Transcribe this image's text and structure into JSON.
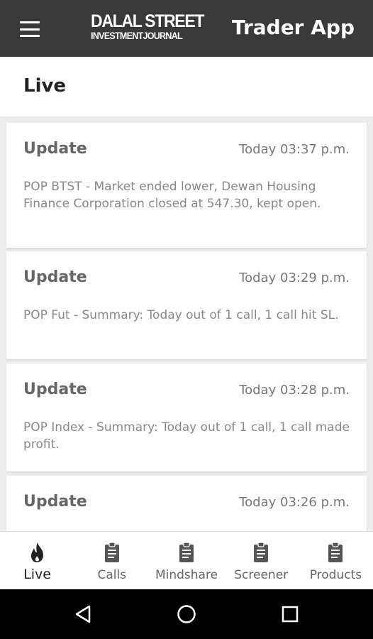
{
  "appbar": {
    "logo_line1": "DALAL STREET",
    "logo_line2": "INVESTMENTJOURNAL",
    "title": "Trader App"
  },
  "section": {
    "title": "Live"
  },
  "feed": [
    {
      "title": "Update",
      "time": "Today 03:37 p.m.",
      "body": "POP BTST - Market ended lower, Dewan Housing Finance Corporation closed at 547.30, kept open."
    },
    {
      "title": "Update",
      "time": "Today 03:29 p.m.",
      "body": "POP Fut - Summary: Today out of 1 call, 1 call hit SL."
    },
    {
      "title": "Update",
      "time": "Today 03:28 p.m.",
      "body": "POP Index - Summary: Today out of 1 call, 1 call made profit."
    },
    {
      "title": "Update",
      "time": "Today 03:26 p.m.",
      "body": ""
    }
  ],
  "bottom_nav": [
    {
      "label": "Live",
      "icon": "flame-icon",
      "active": true
    },
    {
      "label": "Calls",
      "icon": "clipboard-icon",
      "active": false
    },
    {
      "label": "Mindshare",
      "icon": "clipboard-icon",
      "active": false
    },
    {
      "label": "Screener",
      "icon": "clipboard-icon",
      "active": false
    },
    {
      "label": "Products",
      "icon": "clipboard-icon",
      "active": false
    }
  ],
  "system_nav": [
    "back-icon",
    "home-icon",
    "recents-icon"
  ],
  "colors": {
    "appbar_bg": "#3a3939",
    "background": "#ececec",
    "card_bg": "#ffffff",
    "muted_text": "#888888"
  }
}
